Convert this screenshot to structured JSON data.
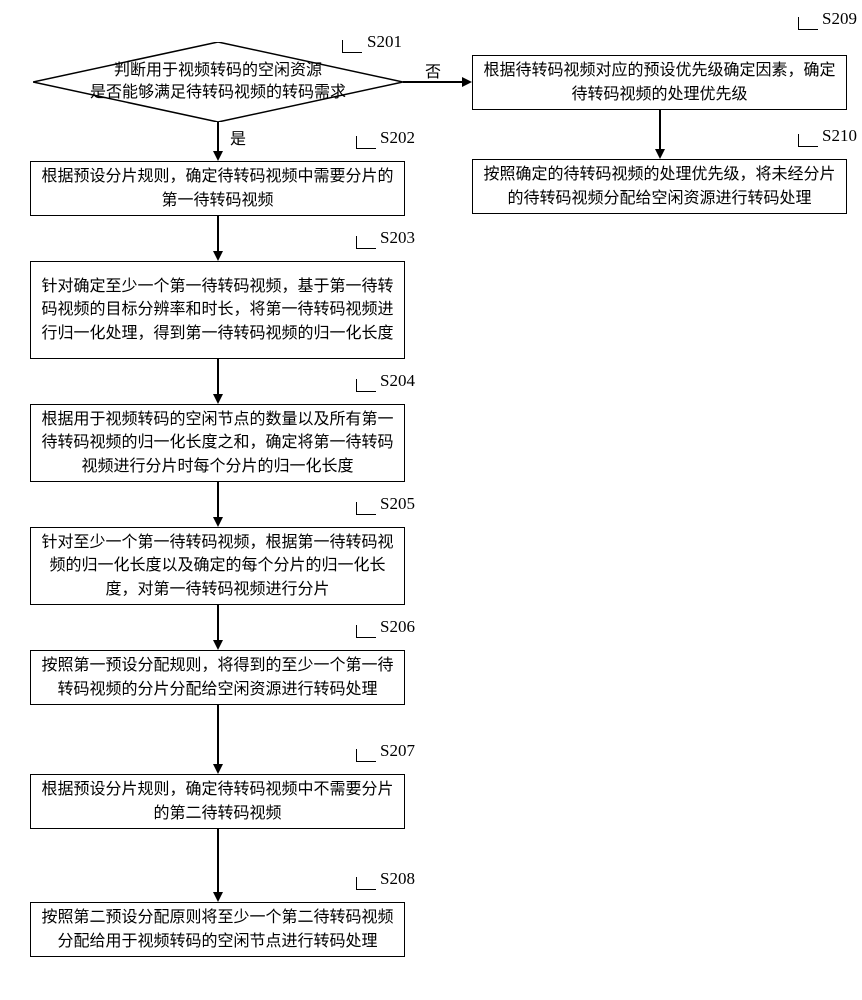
{
  "chart_data": {
    "type": "flowchart",
    "title": "",
    "nodes": [
      {
        "id": "S201",
        "type": "decision",
        "text": "判断用于视频转码的空闲资源\n是否能够满足待转码视频的转码需求"
      },
      {
        "id": "S202",
        "type": "process",
        "text": "根据预设分片规则，确定待转码视频中需要分片\n的第一待转码视频"
      },
      {
        "id": "S203",
        "type": "process",
        "text": "针对确定至少一个第一待转码视频，基于第一\n待转码视频的目标分辨率和时长，将第一待转码\n视频进行归一化处理，得到第一待转码视频的归\n一化长度"
      },
      {
        "id": "S204",
        "type": "process",
        "text": "根据用于视频转码的空闲节点的数量以及所有第\n一待转码视频的归一化长度之和，确定将第一待\n转码视频进行分片时每个分片的归一化长度"
      },
      {
        "id": "S205",
        "type": "process",
        "text": "针对至少一个第一待转码视频，根据第一待转码\n视频的归一化长度以及确定的每个分片的归一化\n长度，对第一待转码视频进行分片"
      },
      {
        "id": "S206",
        "type": "process",
        "text": "按照第一预设分配规则，将得到的至少一个第一\n待转码视频的分片分配给空闲资源进行转码处理"
      },
      {
        "id": "S207",
        "type": "process",
        "text": "根据预设分片规则，确定待转码视频中不需要分\n片的第二待转码视频"
      },
      {
        "id": "S208",
        "type": "process",
        "text": "按照第二预设分配原则将至少一个第二待转码视\n频分配给用于视频转码的空闲节点进行转码处理"
      },
      {
        "id": "S209",
        "type": "process",
        "text": "根据待转码视频对应的预设优先级确定因素，确\n定待转码视频的处理优先级"
      },
      {
        "id": "S210",
        "type": "process",
        "text": "按照确定的待转码视频的处理优先级，将未经分\n片的待转码视频分配给空闲资源进行转码处理"
      }
    ],
    "edges": [
      {
        "from": "S201",
        "to": "S202",
        "label": "是"
      },
      {
        "from": "S201",
        "to": "S209",
        "label": "否"
      },
      {
        "from": "S202",
        "to": "S203"
      },
      {
        "from": "S203",
        "to": "S204"
      },
      {
        "from": "S204",
        "to": "S205"
      },
      {
        "from": "S205",
        "to": "S206"
      },
      {
        "from": "S206",
        "to": "S207"
      },
      {
        "from": "S207",
        "to": "S208"
      },
      {
        "from": "S209",
        "to": "S210"
      }
    ]
  },
  "labels": {
    "s201": "S201",
    "s202": "S202",
    "s203": "S203",
    "s204": "S204",
    "s205": "S205",
    "s206": "S206",
    "s207": "S207",
    "s208": "S208",
    "s209": "S209",
    "s210": "S210",
    "yes": "是",
    "no": "否"
  },
  "boxes": {
    "s201": "判断用于视频转码的空闲资源\n是否能够满足待转码视频的转码需求",
    "s202": "根据预设分片规则，确定待转码视频中需要分片的第一待转码视频",
    "s203": "针对确定至少一个第一待转码视频，基于第一待转码视频的目标分辨率和时长，将第一待转码视频进行归一化处理，得到第一待转码视频的归一化长度",
    "s204": "根据用于视频转码的空闲节点的数量以及所有第一待转码视频的归一化长度之和，确定将第一待转码视频进行分片时每个分片的归一化长度",
    "s205": "针对至少一个第一待转码视频，根据第一待转码视频的归一化长度以及确定的每个分片的归一化长度，对第一待转码视频进行分片",
    "s206": "按照第一预设分配规则，将得到的至少一个第一待转码视频的分片分配给空闲资源进行转码处理",
    "s207": "根据预设分片规则，确定待转码视频中不需要分片的第二待转码视频",
    "s208": "按照第二预设分配原则将至少一个第二待转码视频分配给用于视频转码的空闲节点进行转码处理",
    "s209": "根据待转码视频对应的预设优先级确定因素，确定待转码视频的处理优先级",
    "s210": "按照确定的待转码视频的处理优先级，将未经分片的待转码视频分配给空闲资源进行转码处理"
  }
}
